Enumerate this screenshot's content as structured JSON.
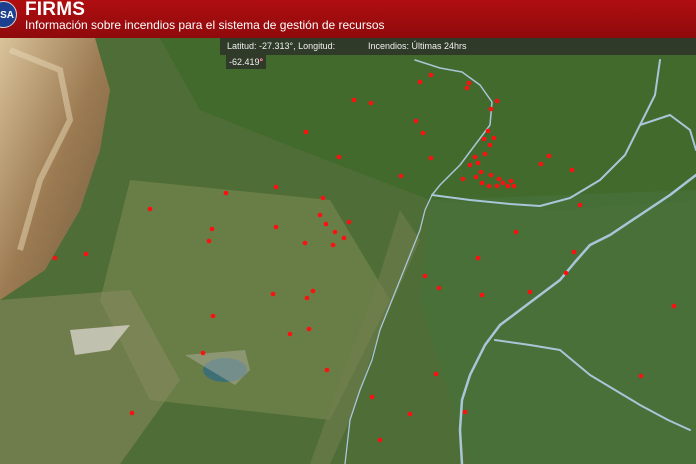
{
  "header": {
    "logo_text": "SA",
    "title": "FIRMS",
    "subtitle": "Información sobre incendios para el sistema de gestión de recursos"
  },
  "infobar": {
    "coordinates_line1": "Latitud: -27.313°, Longitud:",
    "coordinates_line2": "-62.419°",
    "fires_label": "Incendios: Últimas 24hrs"
  },
  "colors": {
    "header_red": "#a10d0f",
    "fire_dot": "#ff1010",
    "river": "#a9c6d8",
    "land": "#4d6a35"
  },
  "fire_count": 115
}
